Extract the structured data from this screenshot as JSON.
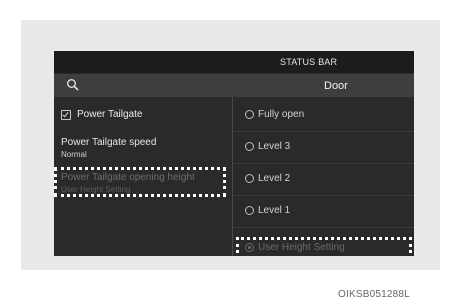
{
  "status_bar": {
    "title": "STATUS BAR"
  },
  "header": {
    "title": "Door",
    "search_icon": "search-icon"
  },
  "left_menu": {
    "power_tailgate": {
      "label": "Power Tailgate",
      "checked": true
    },
    "speed": {
      "title": "Power Tailgate speed",
      "value": "Normal"
    },
    "height": {
      "title": "Power Tailgate opening height",
      "value": "User Height Setting"
    }
  },
  "options": [
    {
      "label": "Fully open",
      "selected": false
    },
    {
      "label": "Level 3",
      "selected": false
    },
    {
      "label": "Level 2",
      "selected": false
    },
    {
      "label": "Level 1",
      "selected": false
    },
    {
      "label": "User Height Setting",
      "selected": true
    }
  ],
  "caption": "OIKSB051288L"
}
